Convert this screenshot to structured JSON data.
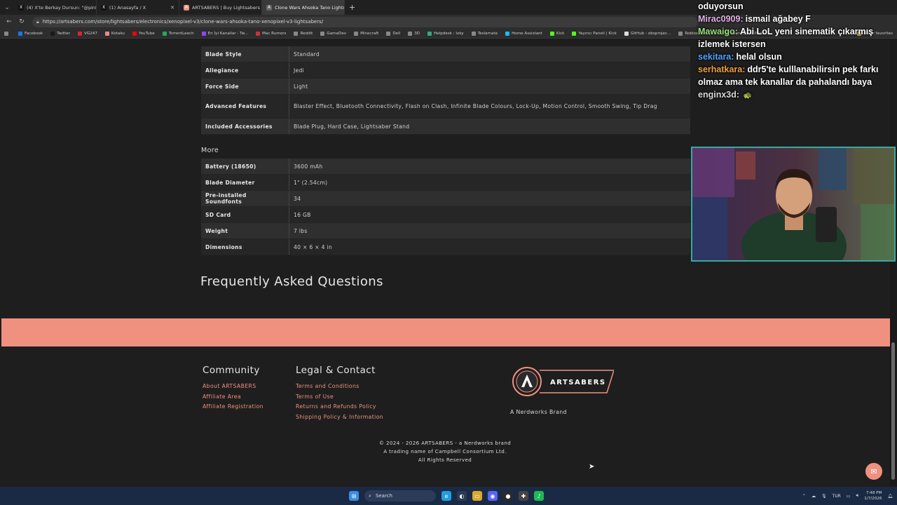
{
  "browser": {
    "tabs": [
      {
        "title": "(4) X'te Berkay Dursun: \"@pinfip...",
        "icon_color": "#1a1a1a",
        "icon": "x-icon",
        "icon_glyph": "X"
      },
      {
        "title": "(1) Anasayfa / X",
        "icon_color": "#1a1a1a",
        "icon": "x-icon",
        "icon_glyph": "X"
      },
      {
        "title": "ARTSABERS | Buy Lightsabers Onli...",
        "icon_color": "#f0917f",
        "icon": "artsabers-icon",
        "icon_glyph": "A"
      },
      {
        "title": "Clone Wars Ahsoka Tano Lightsab...",
        "icon_color": "#555555",
        "icon": "artsabers-icon",
        "icon_glyph": "A",
        "active": true
      }
    ],
    "url": "https://artsabers.com/store/lightsabers/electronics/xenopixel-v3/clone-wars-ahsoka-tano-xenopixel-v3-lightsabers/",
    "bookmarks": [
      {
        "label": "Facebook",
        "color": "#1877f2"
      },
      {
        "label": "Twitter",
        "color": "#1a1a1a"
      },
      {
        "label": "VG247",
        "color": "#d23"
      },
      {
        "label": "Kotaku",
        "color": "#e88"
      },
      {
        "label": "YouTube",
        "color": "#f00"
      },
      {
        "label": "TorrentLeech",
        "color": "#2a5"
      },
      {
        "label": "En İyi Kanallar - Tw...",
        "color": "#9146ff"
      },
      {
        "label": "Mac Rumors",
        "color": "#c33"
      },
      {
        "label": "Reddit",
        "color": "#888"
      },
      {
        "label": "GameDev",
        "color": "#888"
      },
      {
        "label": "Minecraft",
        "color": "#888"
      },
      {
        "label": "Dell",
        "color": "#888"
      },
      {
        "label": "3D",
        "color": "#888"
      },
      {
        "label": "Helpdesk : loky",
        "color": "#3a8"
      },
      {
        "label": "Teslamate",
        "color": "#888"
      },
      {
        "label": "Home Assistant",
        "color": "#18bcf2"
      },
      {
        "label": "Kick",
        "color": "#53fc18"
      },
      {
        "label": "Yayıncı Paneli | Kick",
        "color": "#53fc18"
      },
      {
        "label": "GitHub - obsprojec...",
        "color": "#ddd"
      },
      {
        "label": "Roblox.com | T...",
        "color": "#888"
      },
      {
        "label": "Farm Clone Porto...",
        "color": "#888"
      }
    ],
    "other_favorites": "Other favorites"
  },
  "specs": {
    "rows_top": [
      {
        "key": "Blade Style",
        "value": "Standard"
      },
      {
        "key": "Allegiance",
        "value": "Jedi"
      },
      {
        "key": "Force Side",
        "value": "Light"
      },
      {
        "key": "Advanced Features",
        "value": "Blaster Effect, Bluetooth Connectivity, Flash on Clash, Infinite Blade Colours, Lock-Up, Motion Control, Smooth Swing, Tip Drag",
        "tall": true
      },
      {
        "key": "Included Accessories",
        "value": "Blade Plug, Hard Case, Lightsaber Stand"
      }
    ],
    "more_heading": "More",
    "rows_more": [
      {
        "key": "Battery (18650)",
        "value": "3600 mAh"
      },
      {
        "key": "Blade Diameter",
        "value": "1\" (2.54cm)"
      },
      {
        "key": "Pre-installed Soundfonts",
        "value": "34"
      },
      {
        "key": "SD Card",
        "value": "16 GB"
      },
      {
        "key": "Weight",
        "value": "7 lbs"
      },
      {
        "key": "Dimensions",
        "value": "40 × 6 × 4 in"
      }
    ]
  },
  "faq_heading": "Frequently Asked Questions",
  "footer": {
    "community": {
      "heading": "Community",
      "links": [
        "About ARTSABERS",
        "Affiliate Area",
        "Affiliate Registration"
      ]
    },
    "legal": {
      "heading": "Legal & Contact",
      "links": [
        "Terms and Conditions",
        "Terms of Use",
        "Returns and Refunds Policy",
        "Shipping Policy & Information"
      ]
    },
    "brand_name": "ARTSABERS",
    "brand_tagline": "A Nerdworks Brand",
    "copyright_lines": [
      "© 2024 - 2026 ARTSABERS - a Nerdworks brand",
      "A trading name of Campbell Consortium Ltd.",
      "All Rights Reserved"
    ],
    "accent_color": "#f0917f"
  },
  "stream_chat": [
    {
      "user": "",
      "message": "oduyorsun",
      "user_color": "#ffffff"
    },
    {
      "user": "Mirac0909:",
      "message": "ismail ağabey F",
      "user_color": "#e6b3e6"
    },
    {
      "user": "Mawaigo:",
      "message": "Abi LoL yeni sinematik çıkarmış izlemek istersen",
      "user_color": "#9be07c"
    },
    {
      "user": "sekitara:",
      "message": "helal olsun",
      "user_color": "#4fa3ff"
    },
    {
      "user": "serhatkara:",
      "message": "ddr5'te kulllanabilirsin pek farkı olmaz ama tek kanallar da pahalandı baya",
      "user_color": "#f0a040"
    },
    {
      "user": "enginx3d:",
      "message": "",
      "user_color": "#d8d8d8",
      "emote": "turtle-emote"
    }
  ],
  "taskbar": {
    "search_label": "Search",
    "lang": "TUR",
    "time": "7:48 PM",
    "date": "1/7/2026"
  }
}
